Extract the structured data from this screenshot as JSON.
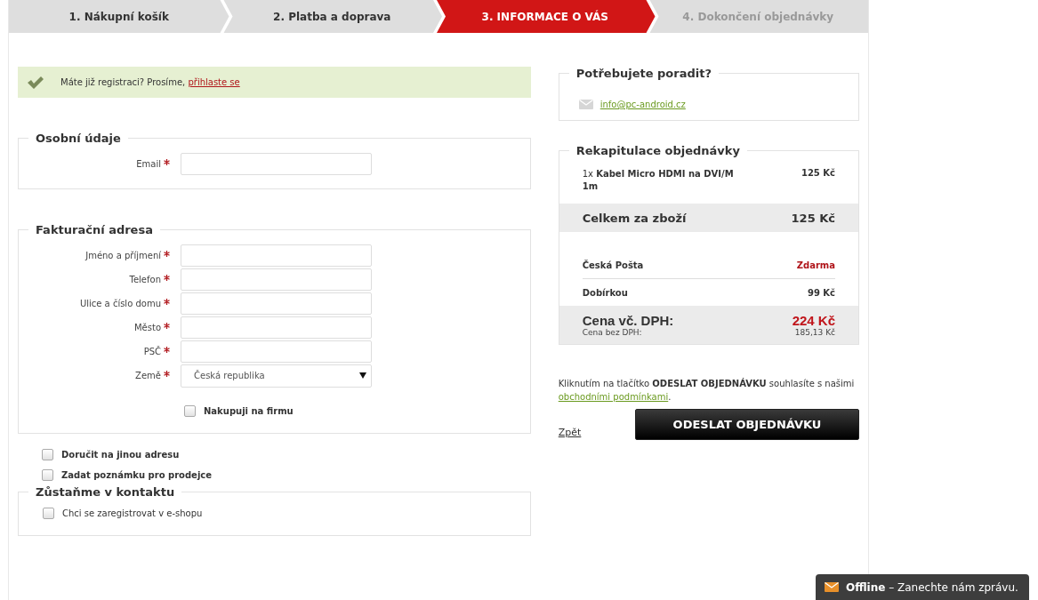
{
  "steps": [
    {
      "label": "1. Nákupní košík",
      "selected": false,
      "done": true
    },
    {
      "label": "2. Platba a doprava",
      "selected": false,
      "done": true
    },
    {
      "label": "3. INFORMACE O VÁS",
      "selected": true,
      "done": false
    },
    {
      "label": "4. Dokončení objednávky",
      "selected": false,
      "done": false
    }
  ],
  "login_notice": {
    "text": "Máte již registraci? Prosíme,",
    "link": "přihlaste se"
  },
  "personal": {
    "legend": "Osobní údaje",
    "fields": [
      {
        "label": "Email",
        "required": true,
        "kind": "text"
      }
    ]
  },
  "billing": {
    "legend": "Fakturační adresa",
    "fields": [
      {
        "label": "Jméno a příjmení",
        "required": true,
        "kind": "text"
      },
      {
        "label": "Telefon",
        "required": true,
        "kind": "text"
      },
      {
        "label": "Ulice a číslo domu",
        "required": true,
        "kind": "text"
      },
      {
        "label": "Město",
        "required": true,
        "kind": "text"
      },
      {
        "label": "PSČ",
        "required": true,
        "kind": "text"
      },
      {
        "label": "Země",
        "required": true,
        "kind": "select",
        "value": "Česká republika"
      }
    ],
    "company": {
      "label": "Nakupuji na firmu",
      "checked": false
    }
  },
  "options": [
    {
      "label": "Doručit na jinou adresu",
      "checked": false
    },
    {
      "label": "Zadat poznámku pro prodejce",
      "checked": false
    }
  ],
  "contact": {
    "legend": "Zůstaňme v kontaktu",
    "checkbox": {
      "label": "Chci se zaregistrovat v e-shopu",
      "checked": false
    }
  },
  "help": {
    "legend": "Potřebujete poradit?",
    "email": "info@pc-android.cz"
  },
  "summary": {
    "legend": "Rekapitulace objednávky",
    "items": [
      {
        "qty": "1x",
        "name": "Kabel Micro HDMI na DVI/M 1m",
        "price": "125 Kč"
      }
    ],
    "subtotal": {
      "label": "Celkem za zboží",
      "value": "125 Kč"
    },
    "charges": [
      {
        "label": "Česká Pošta",
        "value": "Zdarma",
        "free": true
      },
      {
        "label": "Dobírkou",
        "value": "99 Kč",
        "free": false
      }
    ],
    "total": {
      "label": "Cena vč. DPH:",
      "value": "224 Kč"
    },
    "total_net": {
      "label": "Cena bez DPH:",
      "value": "185,13 Kč"
    }
  },
  "terms": {
    "text": "Kliknutím na tlačítko **ODESLAT OBJEDNÁVKU** souhlasíte s našimi",
    "link": "obchodními podmínkami",
    "end": "."
  },
  "back_link": "Zpět",
  "submit": "ODESLAT OBJEDNÁVKU",
  "chat": {
    "status": "Offline",
    "message": "– Zanechte nám zprávu."
  }
}
